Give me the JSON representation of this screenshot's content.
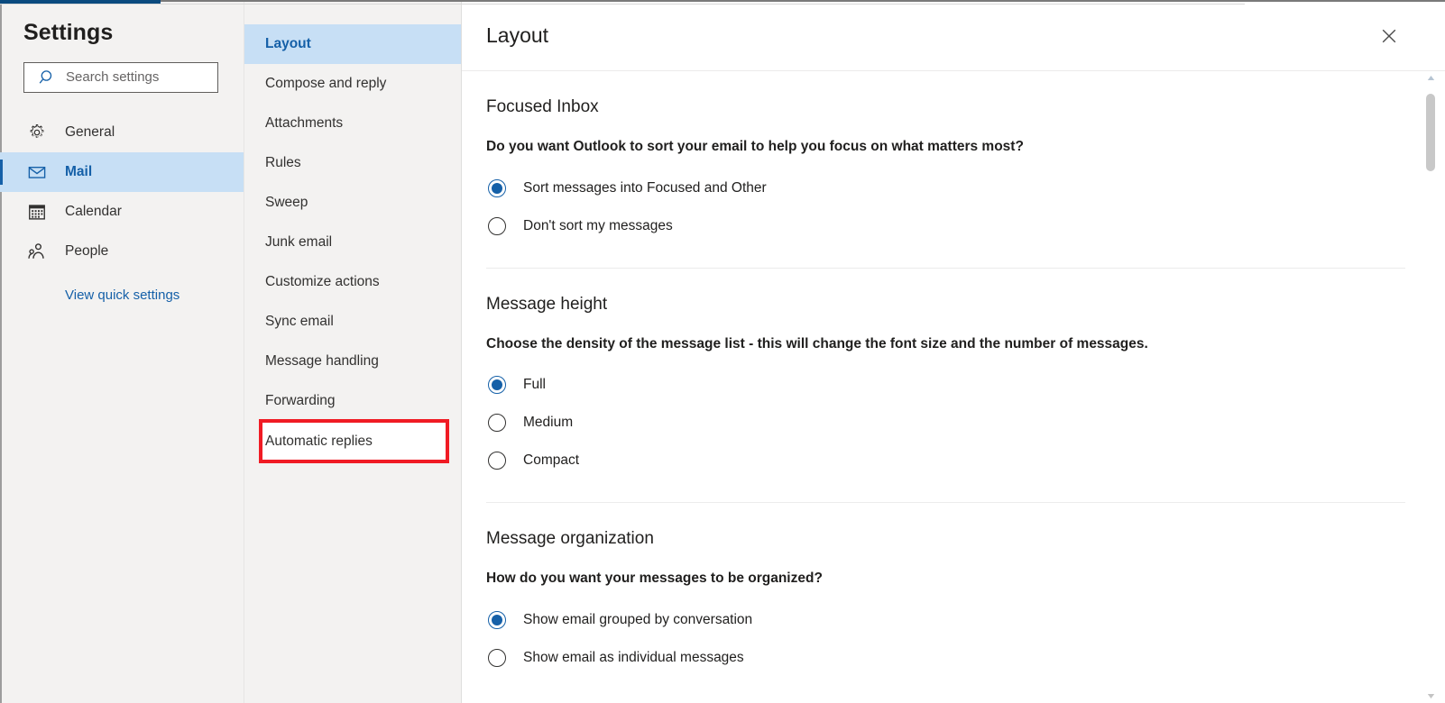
{
  "window": {
    "accent_color": "#0b4b7f",
    "selection_bg": "#c7dff5",
    "link_color": "#1560a8",
    "highlight_color": "#f01b24"
  },
  "sidebar": {
    "title": "Settings",
    "search": {
      "placeholder": "Search settings",
      "value": "",
      "icon": "search-icon"
    },
    "items": [
      {
        "label": "General",
        "icon": "gear-icon",
        "selected": false
      },
      {
        "label": "Mail",
        "icon": "envelope-icon",
        "selected": true
      },
      {
        "label": "Calendar",
        "icon": "calendar-icon",
        "selected": false
      },
      {
        "label": "People",
        "icon": "people-icon",
        "selected": false
      }
    ],
    "quick_settings_link": "View quick settings"
  },
  "subnav": {
    "items": [
      {
        "label": "Layout",
        "selected": true,
        "highlighted": false
      },
      {
        "label": "Compose and reply",
        "selected": false,
        "highlighted": false
      },
      {
        "label": "Attachments",
        "selected": false,
        "highlighted": false
      },
      {
        "label": "Rules",
        "selected": false,
        "highlighted": false
      },
      {
        "label": "Sweep",
        "selected": false,
        "highlighted": false
      },
      {
        "label": "Junk email",
        "selected": false,
        "highlighted": false
      },
      {
        "label": "Customize actions",
        "selected": false,
        "highlighted": false
      },
      {
        "label": "Sync email",
        "selected": false,
        "highlighted": false
      },
      {
        "label": "Message handling",
        "selected": false,
        "highlighted": false
      },
      {
        "label": "Forwarding",
        "selected": false,
        "highlighted": false
      },
      {
        "label": "Automatic replies",
        "selected": false,
        "highlighted": true
      }
    ]
  },
  "content": {
    "title": "Layout",
    "close_icon": "close-icon",
    "sections": [
      {
        "title": "Focused Inbox",
        "question": "Do you want Outlook to sort your email to help you focus on what matters most?",
        "options": [
          {
            "label": "Sort messages into Focused and Other",
            "checked": true
          },
          {
            "label": "Don't sort my messages",
            "checked": false
          }
        ]
      },
      {
        "title": "Message height",
        "question": "Choose the density of the message list - this will change the font size and the number of messages.",
        "options": [
          {
            "label": "Full",
            "checked": true
          },
          {
            "label": "Medium",
            "checked": false
          },
          {
            "label": "Compact",
            "checked": false
          }
        ]
      },
      {
        "title": "Message organization",
        "question": "How do you want your messages to be organized?",
        "options": [
          {
            "label": "Show email grouped by conversation",
            "checked": true
          },
          {
            "label": "Show email as individual messages",
            "checked": false
          }
        ]
      }
    ]
  },
  "scrollbar": {
    "up_icon": "chevron-up-icon",
    "down_icon": "chevron-down-icon"
  }
}
